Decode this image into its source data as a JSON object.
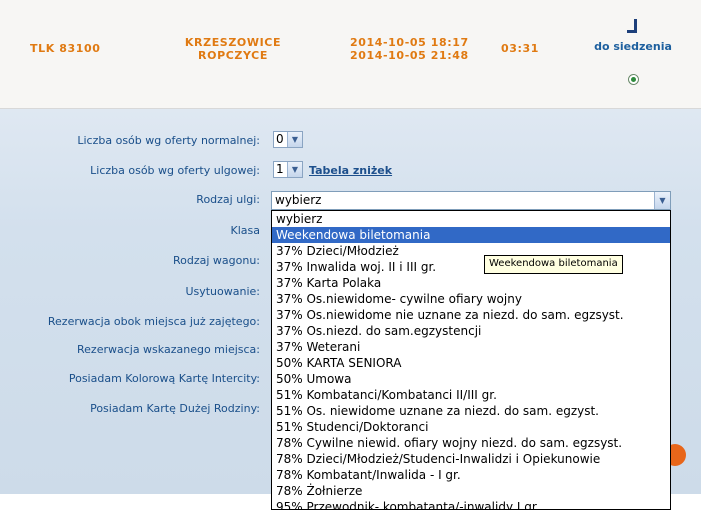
{
  "journey": {
    "train": "TLK 83100",
    "from": "KRZESZOWICE",
    "to": "ROPCZYCE",
    "departure": "2014-10-05 18:17",
    "arrival": "2014-10-05 21:48",
    "duration": "03:31",
    "seat_link": "do siedzenia"
  },
  "form": {
    "normal_label": "Liczba osób wg oferty normalnej:",
    "normal_value": "0",
    "discount_label": "Liczba osób wg oferty ulgowej:",
    "discount_value": "1",
    "discount_table_link": "Tabela zniżek",
    "relief_type_label": "Rodzaj ulgi:",
    "relief_type_value": "wybierz",
    "class_label": "Klasa",
    "wagon_label": "Rodzaj wagonu:",
    "position_label": "Usytuowanie:",
    "reservation_next_label": "Rezerwacja obok miejsca już zajętego:",
    "reservation_indicated_label": "Rezerwacja wskazanego miejsca:",
    "intercity_card_label": "Posiadam Kolorową Kartę Intercity:",
    "big_family_card_label": "Posiadam Kartę Dużej Rodziny:"
  },
  "dropdown": {
    "options": [
      "wybierz",
      "Weekendowa biletomania",
      "37% Dzieci/Młodzież",
      "37% Inwalida woj. II i III gr.",
      "37% Karta Polaka",
      "37% Os.niewidome- cywilne ofiary wojny",
      "37% Os.niewidome nie uznane za niezd. do sam. egzsyst.",
      "37% Os.niezd. do sam.egzystencji",
      "37% Weterani",
      "50% KARTA SENIORA",
      "50% Umowa",
      "51% Kombatanci/Kombatanci II/III gr.",
      "51% Os. niewidome uznane za niezd. do sam. egzyst.",
      "51% Studenci/Doktoranci",
      "78% Cywilne niewid. ofiary wojny niezd. do sam. egzsyst.",
      "78% Dzieci/Młodzież/Studenci-Inwalidzi i Opiekunowie",
      "78% Kombatant/Inwalida - I gr.",
      "78% Żołnierze",
      "95% Przewodnik- kombatanta/-inwalidy I gr."
    ],
    "highlighted_index": 1,
    "tooltip": "Weekendowa biletomania"
  },
  "colors": {
    "accent_orange": "#e07a12",
    "link_blue": "#1d5f9e",
    "selection_blue": "#3169c6"
  },
  "icons": {
    "seat": "seat-icon",
    "dropdown_arrow": "chevron-down-icon",
    "radio": "radio-selected-icon"
  }
}
